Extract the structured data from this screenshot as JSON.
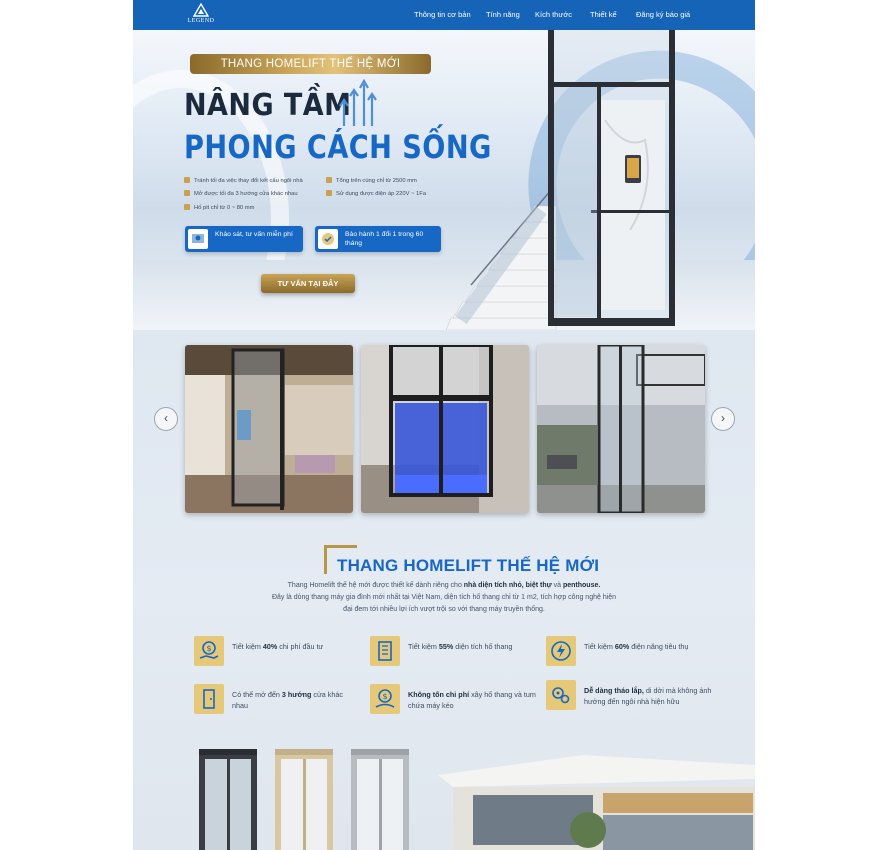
{
  "nav": {
    "logo_text": "LEGEND",
    "items": [
      "Thông tin cơ bản",
      "Tính năng",
      "Kích thước",
      "Thiết kế",
      "Đăng ký báo giá"
    ]
  },
  "hero": {
    "badge": "THANG HOMELIFT THẾ HỆ MỚI",
    "headline_line1": "NÂNG TẦM",
    "headline_line2": "PHONG CÁCH SỐNG",
    "features": [
      "Tránh tối đa việc thay đổi kết cấu ngôi nhà",
      "Tổng trên cùng chỉ từ 2500 mm",
      "Mở được tối đa 3 hướng cửa khác nhau",
      "Sử dụng được điện áp 220V ~ 1Fa",
      "Hố pit chỉ từ 0 ~ 80 mm"
    ],
    "promo1": "Khảo sát, tư vấn miễn phí",
    "promo2": "Bảo hành 1 đổi 1 trong 60 tháng",
    "cta": "TƯ VẤN TẠI ĐÂY"
  },
  "gallery": {
    "prev_icon": "‹",
    "next_icon": "›"
  },
  "section": {
    "title": "THANG HOMELIFT THẾ HỆ MỚI",
    "desc_p1": "Thang Homelift thế hệ mới được thiết kế dành riêng cho ",
    "desc_b1": "nhà diện tích nhỏ, biệt thự",
    "desc_p2": " và ",
    "desc_b2": "penthouse.",
    "desc_p3": "Đây là dòng thang máy gia đình mới nhất tại Việt Nam, diện tích hố thang chỉ từ 1 m2, tích hợp công nghệ hiện đại đem tới nhiều lợi ích vượt trội so với thang máy truyền thống.",
    "benefits": [
      {
        "pre": "Tiết kiệm ",
        "bold": "40%",
        "post": " chi phí đầu tư"
      },
      {
        "pre": "Tiết kiệm ",
        "bold": "55%",
        "post": " diện tích hố thang"
      },
      {
        "pre": "Tiết kiệm ",
        "bold": "60%",
        "post": " điện năng tiêu thụ"
      },
      {
        "pre": "Có thể mở đến ",
        "bold": "3 hướng",
        "post": " cửa khác nhau"
      },
      {
        "pre": "",
        "bold": "Không tốn chi phí",
        "post": " xây hố thang và tum chứa máy kéo"
      },
      {
        "pre": "",
        "bold": "Dễ dàng tháo lắp,",
        "post": " di dời mà không ảnh hưởng đến ngôi nhà hiện hữu"
      }
    ]
  },
  "colors": {
    "brand_blue": "#1668c4",
    "gold": "#c9a457",
    "nav": "#1564b8"
  }
}
